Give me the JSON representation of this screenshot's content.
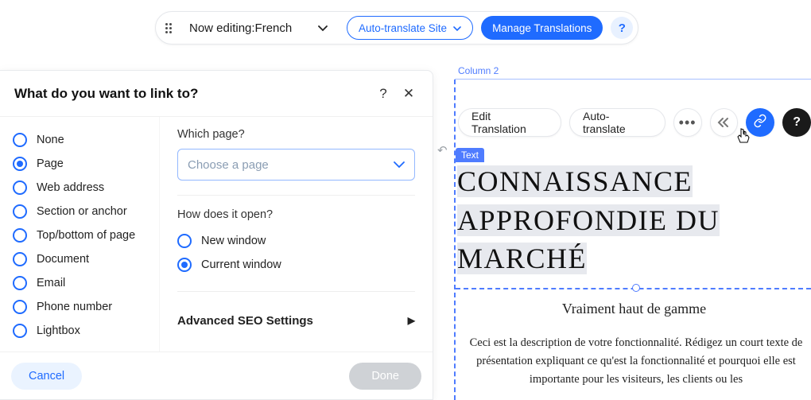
{
  "topbar": {
    "editing_prefix": "Now editing: ",
    "language": "French",
    "auto_translate_site": "Auto-translate Site",
    "manage_translations": "Manage Translations",
    "help": "?"
  },
  "panel": {
    "title": "What do you want to link to?",
    "help": "?",
    "close": "✕",
    "link_types": [
      "None",
      "Page",
      "Web address",
      "Section or anchor",
      "Top/bottom of page",
      "Document",
      "Email",
      "Phone number",
      "Lightbox"
    ],
    "selected_link_type": "Page",
    "which_page_label": "Which page?",
    "which_page_placeholder": "Choose a page",
    "open_label": "How does it open?",
    "open_options": [
      "New window",
      "Current window"
    ],
    "selected_open": "Current window",
    "seo_label": "Advanced SEO Settings",
    "cancel": "Cancel",
    "done": "Done"
  },
  "canvas": {
    "column_label": "Column 2",
    "edit_translation": "Edit Translation",
    "auto_translate": "Auto-translate",
    "text_badge": "Text",
    "heading_line1": "CONNAISSANCE",
    "heading_line2": "APPROFONDIE DU",
    "heading_line3": "MARCHÉ",
    "subhead": "Vraiment haut de gamme",
    "body": "Ceci est la description de votre fonctionnalité. Rédigez un court texte de présentation expliquant ce qu'est la fonctionnalité et pourquoi elle est importante pour les visiteurs, les clients ou les"
  }
}
